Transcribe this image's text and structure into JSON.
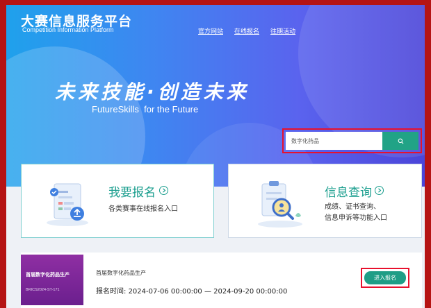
{
  "header": {
    "title": "大赛信息服务平台",
    "subtitle": "Competition Information Platform",
    "nav": [
      "官方网站",
      "在线报名",
      "往期活动"
    ]
  },
  "hero": {
    "slogan_cn": "未来技能·创造未来",
    "slogan_en": "FutureSkills  for the Future"
  },
  "search": {
    "value": "数字化药品",
    "button_icon": "search-icon"
  },
  "cards": {
    "register": {
      "title": "我要报名",
      "desc": "各类赛事在线报名入口",
      "icon": "registration-form-icon"
    },
    "query": {
      "title": "信息查询",
      "desc_line1": "成绩、证书查询、",
      "desc_line2": "信息申诉等功能入口",
      "icon": "search-document-icon"
    }
  },
  "competition": {
    "thumb_title": "首届数字化药品生产",
    "thumb_code": "BRICS2024-ST-171",
    "name": "首届数字化药品生产",
    "time_label": "报名时间: ",
    "time_range": "2024-07-06 00:00:00 — 2024-09-20 00:00:00",
    "enter_label": "进入报名"
  },
  "colors": {
    "accent": "#1f9d86",
    "highlight": "#e8112d",
    "outer_border": "#b51414"
  }
}
